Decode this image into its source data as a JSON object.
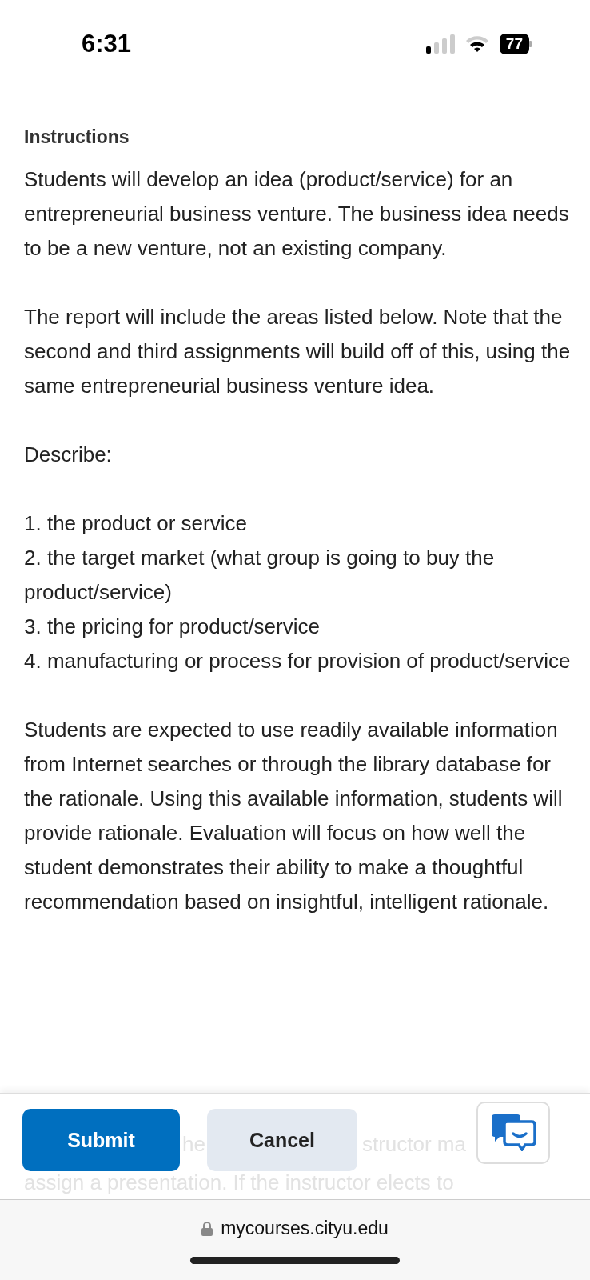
{
  "status_bar": {
    "time": "6:31",
    "battery": "77"
  },
  "heading": "Instructions",
  "blocks": [
    {
      "kind": "paragraph",
      "text": "Students will develop an idea (product/service) for an entrepreneurial business venture.  The business idea needs to be a new venture, not an existing company."
    },
    {
      "kind": "paragraph",
      "text": "The report will include the areas listed below. Note that the second and third assignments will build off of this, using the same entrepreneurial business venture idea."
    },
    {
      "kind": "paragraph",
      "text": "Describe:"
    },
    {
      "kind": "list",
      "items": [
        "1. the product or service",
        "2. the target market (what group is going to buy the product/service)",
        "3. the pricing for product/service",
        "4. manufacturing or process for provision of product/service"
      ]
    },
    {
      "kind": "paragraph",
      "text": "Students are expected to use readily available information from Internet searches or through the library database for the rationale. Using this available information, students will provide rationale. Evaluation will focus on how well the student demonstrates their ability to make a thoughtful recommendation based on insightful, intelligent rationale."
    }
  ],
  "toolbar": {
    "submit": "Submit",
    "cancel": "Cancel",
    "behind_fragments": [
      "he",
      "structor ma"
    ],
    "behind_line": "assign a presentation. If the instructor elects to"
  },
  "address_bar": {
    "url": "mycourses.cityu.edu"
  }
}
